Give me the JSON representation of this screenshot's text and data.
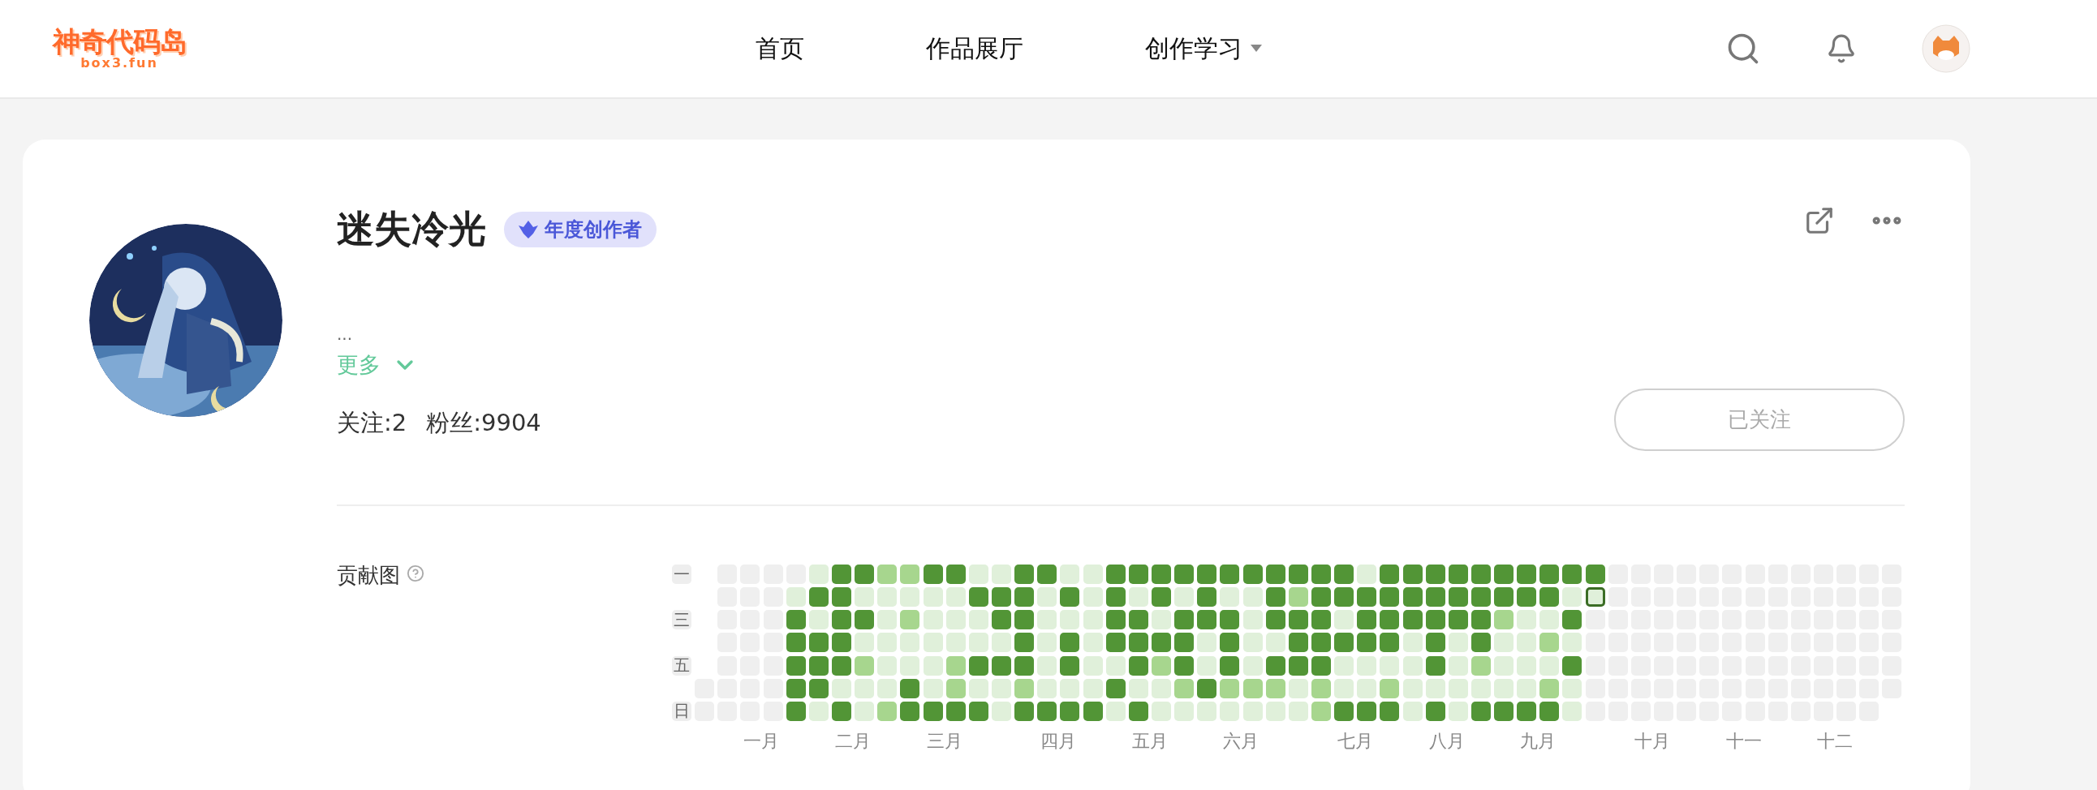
{
  "header": {
    "logo": {
      "title": "神奇代码岛",
      "subtitle": "box3.fun"
    },
    "nav": [
      {
        "label": "首页",
        "dropdown": false
      },
      {
        "label": "作品展厅",
        "dropdown": false
      },
      {
        "label": "创作学习",
        "dropdown": true
      }
    ]
  },
  "profile": {
    "avatar": {
      "kind": "picture"
    },
    "name": "迷失冷光",
    "badge": "年度创作者",
    "bio": "...",
    "more_link": "更多",
    "stats": [
      "关注:2",
      "粉丝:9904"
    ],
    "follow_button": {
      "label": "已关注",
      "following": true
    }
  },
  "contributions": {
    "title": "贡献图",
    "rows": [
      {
        "label": "一",
        "cells": [
          null,
          {
            "kind": "blank"
          },
          {
            "kind": "blank"
          },
          {
            "kind": "blank"
          },
          {
            "kind": "blank"
          },
          {
            "kind": "zero"
          },
          {
            "kind": "high"
          },
          {
            "kind": "high"
          },
          {
            "kind": "low"
          },
          {
            "kind": "low"
          },
          {
            "kind": "high"
          },
          {
            "kind": "high"
          },
          {
            "kind": "zero"
          },
          {
            "kind": "zero"
          },
          {
            "kind": "high"
          },
          {
            "kind": "high"
          },
          {
            "kind": "zero"
          },
          {
            "kind": "zero"
          },
          {
            "kind": "high"
          },
          {
            "kind": "high"
          },
          {
            "kind": "high"
          },
          {
            "kind": "high"
          },
          {
            "kind": "high"
          },
          {
            "kind": "high"
          },
          {
            "kind": "high"
          },
          {
            "kind": "high"
          },
          {
            "kind": "high"
          },
          {
            "kind": "high"
          },
          {
            "kind": "high"
          },
          {
            "kind": "zero"
          },
          {
            "kind": "high"
          },
          {
            "kind": "high"
          },
          {
            "kind": "high"
          },
          {
            "kind": "high"
          },
          {
            "kind": "high"
          },
          {
            "kind": "high"
          },
          {
            "kind": "high"
          },
          {
            "kind": "high"
          },
          {
            "kind": "high"
          },
          {
            "kind": "high"
          },
          {
            "kind": "blank"
          },
          {
            "kind": "blank"
          },
          {
            "kind": "blank"
          },
          {
            "kind": "blank"
          },
          {
            "kind": "blank"
          },
          {
            "kind": "blank"
          },
          {
            "kind": "blank"
          },
          {
            "kind": "blank"
          },
          {
            "kind": "blank"
          },
          {
            "kind": "blank"
          },
          {
            "kind": "blank"
          },
          {
            "kind": "blank"
          },
          {
            "kind": "blank"
          }
        ]
      },
      {
        "cells": [
          null,
          {
            "kind": "blank"
          },
          {
            "kind": "blank"
          },
          {
            "kind": "blank"
          },
          {
            "kind": "zero"
          },
          {
            "kind": "high"
          },
          {
            "kind": "high"
          },
          {
            "kind": "zero"
          },
          {
            "kind": "zero"
          },
          {
            "kind": "zero"
          },
          {
            "kind": "zero"
          },
          {
            "kind": "zero"
          },
          {
            "kind": "high"
          },
          {
            "kind": "high"
          },
          {
            "kind": "high"
          },
          {
            "kind": "zero"
          },
          {
            "kind": "high"
          },
          {
            "kind": "zero"
          },
          {
            "kind": "high"
          },
          {
            "kind": "zero"
          },
          {
            "kind": "high"
          },
          {
            "kind": "zero"
          },
          {
            "kind": "high"
          },
          {
            "kind": "zero"
          },
          {
            "kind": "zero"
          },
          {
            "kind": "high"
          },
          {
            "kind": "low"
          },
          {
            "kind": "high"
          },
          {
            "kind": "high"
          },
          {
            "kind": "high"
          },
          {
            "kind": "high"
          },
          {
            "kind": "high"
          },
          {
            "kind": "high"
          },
          {
            "kind": "high"
          },
          {
            "kind": "high"
          },
          {
            "kind": "high"
          },
          {
            "kind": "high"
          },
          {
            "kind": "high"
          },
          {
            "kind": "zero"
          },
          {
            "kind": "today"
          },
          {
            "kind": "blank"
          },
          {
            "kind": "blank"
          },
          {
            "kind": "blank"
          },
          {
            "kind": "blank"
          },
          {
            "kind": "blank"
          },
          {
            "kind": "blank"
          },
          {
            "kind": "blank"
          },
          {
            "kind": "blank"
          },
          {
            "kind": "blank"
          },
          {
            "kind": "blank"
          },
          {
            "kind": "blank"
          },
          {
            "kind": "blank"
          },
          {
            "kind": "blank"
          }
        ]
      },
      {
        "label": "三",
        "cells": [
          null,
          {
            "kind": "blank"
          },
          {
            "kind": "blank"
          },
          {
            "kind": "blank"
          },
          {
            "kind": "high"
          },
          {
            "kind": "zero"
          },
          {
            "kind": "high"
          },
          {
            "kind": "high"
          },
          {
            "kind": "zero"
          },
          {
            "kind": "low"
          },
          {
            "kind": "zero"
          },
          {
            "kind": "zero"
          },
          {
            "kind": "zero"
          },
          {
            "kind": "high"
          },
          {
            "kind": "high"
          },
          {
            "kind": "zero"
          },
          {
            "kind": "zero"
          },
          {
            "kind": "zero"
          },
          {
            "kind": "high"
          },
          {
            "kind": "high"
          },
          {
            "kind": "zero"
          },
          {
            "kind": "high"
          },
          {
            "kind": "high"
          },
          {
            "kind": "high"
          },
          {
            "kind": "zero"
          },
          {
            "kind": "high"
          },
          {
            "kind": "high"
          },
          {
            "kind": "high"
          },
          {
            "kind": "zero"
          },
          {
            "kind": "high"
          },
          {
            "kind": "high"
          },
          {
            "kind": "high"
          },
          {
            "kind": "high"
          },
          {
            "kind": "high"
          },
          {
            "kind": "high"
          },
          {
            "kind": "low"
          },
          {
            "kind": "zero"
          },
          {
            "kind": "zero"
          },
          {
            "kind": "high"
          },
          {
            "kind": "blank"
          },
          {
            "kind": "blank"
          },
          {
            "kind": "blank"
          },
          {
            "kind": "blank"
          },
          {
            "kind": "blank"
          },
          {
            "kind": "blank"
          },
          {
            "kind": "blank"
          },
          {
            "kind": "blank"
          },
          {
            "kind": "blank"
          },
          {
            "kind": "blank"
          },
          {
            "kind": "blank"
          },
          {
            "kind": "blank"
          },
          {
            "kind": "blank"
          },
          {
            "kind": "blank"
          }
        ]
      },
      {
        "cells": [
          null,
          {
            "kind": "blank"
          },
          {
            "kind": "blank"
          },
          {
            "kind": "blank"
          },
          {
            "kind": "high"
          },
          {
            "kind": "high"
          },
          {
            "kind": "high"
          },
          {
            "kind": "zero"
          },
          {
            "kind": "zero"
          },
          {
            "kind": "zero"
          },
          {
            "kind": "zero"
          },
          {
            "kind": "zero"
          },
          {
            "kind": "zero"
          },
          {
            "kind": "zero"
          },
          {
            "kind": "high"
          },
          {
            "kind": "zero"
          },
          {
            "kind": "high"
          },
          {
            "kind": "zero"
          },
          {
            "kind": "high"
          },
          {
            "kind": "high"
          },
          {
            "kind": "high"
          },
          {
            "kind": "high"
          },
          {
            "kind": "zero"
          },
          {
            "kind": "high"
          },
          {
            "kind": "zero"
          },
          {
            "kind": "zero"
          },
          {
            "kind": "high"
          },
          {
            "kind": "high"
          },
          {
            "kind": "high"
          },
          {
            "kind": "high"
          },
          {
            "kind": "high"
          },
          {
            "kind": "zero"
          },
          {
            "kind": "high"
          },
          {
            "kind": "zero"
          },
          {
            "kind": "high"
          },
          {
            "kind": "zero"
          },
          {
            "kind": "zero"
          },
          {
            "kind": "low"
          },
          {
            "kind": "zero"
          },
          {
            "kind": "blank"
          },
          {
            "kind": "blank"
          },
          {
            "kind": "blank"
          },
          {
            "kind": "blank"
          },
          {
            "kind": "blank"
          },
          {
            "kind": "blank"
          },
          {
            "kind": "blank"
          },
          {
            "kind": "blank"
          },
          {
            "kind": "blank"
          },
          {
            "kind": "blank"
          },
          {
            "kind": "blank"
          },
          {
            "kind": "blank"
          },
          {
            "kind": "blank"
          },
          {
            "kind": "blank"
          }
        ]
      },
      {
        "label": "五",
        "cells": [
          null,
          {
            "kind": "blank"
          },
          {
            "kind": "blank"
          },
          {
            "kind": "blank"
          },
          {
            "kind": "high"
          },
          {
            "kind": "high"
          },
          {
            "kind": "high"
          },
          {
            "kind": "low"
          },
          {
            "kind": "zero"
          },
          {
            "kind": "zero"
          },
          {
            "kind": "zero"
          },
          {
            "kind": "low"
          },
          {
            "kind": "high"
          },
          {
            "kind": "high"
          },
          {
            "kind": "high"
          },
          {
            "kind": "zero"
          },
          {
            "kind": "high"
          },
          {
            "kind": "zero"
          },
          {
            "kind": "zero"
          },
          {
            "kind": "high"
          },
          {
            "kind": "low"
          },
          {
            "kind": "high"
          },
          {
            "kind": "zero"
          },
          {
            "kind": "high"
          },
          {
            "kind": "zero"
          },
          {
            "kind": "high"
          },
          {
            "kind": "high"
          },
          {
            "kind": "high"
          },
          {
            "kind": "zero"
          },
          {
            "kind": "zero"
          },
          {
            "kind": "zero"
          },
          {
            "kind": "zero"
          },
          {
            "kind": "high"
          },
          {
            "kind": "zero"
          },
          {
            "kind": "low"
          },
          {
            "kind": "zero"
          },
          {
            "kind": "zero"
          },
          {
            "kind": "zero"
          },
          {
            "kind": "high"
          },
          {
            "kind": "blank"
          },
          {
            "kind": "blank"
          },
          {
            "kind": "blank"
          },
          {
            "kind": "blank"
          },
          {
            "kind": "blank"
          },
          {
            "kind": "blank"
          },
          {
            "kind": "blank"
          },
          {
            "kind": "blank"
          },
          {
            "kind": "blank"
          },
          {
            "kind": "blank"
          },
          {
            "kind": "blank"
          },
          {
            "kind": "blank"
          },
          {
            "kind": "blank"
          },
          {
            "kind": "blank"
          }
        ]
      },
      {
        "cells": [
          {
            "kind": "blank"
          },
          {
            "kind": "blank"
          },
          {
            "kind": "blank"
          },
          {
            "kind": "blank"
          },
          {
            "kind": "high"
          },
          {
            "kind": "high"
          },
          {
            "kind": "zero"
          },
          {
            "kind": "zero"
          },
          {
            "kind": "zero"
          },
          {
            "kind": "high"
          },
          {
            "kind": "zero"
          },
          {
            "kind": "low"
          },
          {
            "kind": "zero"
          },
          {
            "kind": "zero"
          },
          {
            "kind": "low"
          },
          {
            "kind": "zero"
          },
          {
            "kind": "zero"
          },
          {
            "kind": "zero"
          },
          {
            "kind": "high"
          },
          {
            "kind": "zero"
          },
          {
            "kind": "zero"
          },
          {
            "kind": "low"
          },
          {
            "kind": "high"
          },
          {
            "kind": "low"
          },
          {
            "kind": "low"
          },
          {
            "kind": "low"
          },
          {
            "kind": "zero"
          },
          {
            "kind": "low"
          },
          {
            "kind": "zero"
          },
          {
            "kind": "zero"
          },
          {
            "kind": "low"
          },
          {
            "kind": "zero"
          },
          {
            "kind": "zero"
          },
          {
            "kind": "zero"
          },
          {
            "kind": "zero"
          },
          {
            "kind": "zero"
          },
          {
            "kind": "zero"
          },
          {
            "kind": "low"
          },
          {
            "kind": "zero"
          },
          {
            "kind": "blank"
          },
          {
            "kind": "blank"
          },
          {
            "kind": "blank"
          },
          {
            "kind": "blank"
          },
          {
            "kind": "blank"
          },
          {
            "kind": "blank"
          },
          {
            "kind": "blank"
          },
          {
            "kind": "blank"
          },
          {
            "kind": "blank"
          },
          {
            "kind": "blank"
          },
          {
            "kind": "blank"
          },
          {
            "kind": "blank"
          },
          {
            "kind": "blank"
          },
          {
            "kind": "blank"
          }
        ]
      },
      {
        "label": "日",
        "cells": [
          {
            "kind": "blank"
          },
          {
            "kind": "blank"
          },
          {
            "kind": "blank"
          },
          {
            "kind": "blank"
          },
          {
            "kind": "high"
          },
          {
            "kind": "zero"
          },
          {
            "kind": "high"
          },
          {
            "kind": "zero"
          },
          {
            "kind": "low"
          },
          {
            "kind": "high"
          },
          {
            "kind": "high"
          },
          {
            "kind": "high"
          },
          {
            "kind": "high"
          },
          {
            "kind": "zero"
          },
          {
            "kind": "high"
          },
          {
            "kind": "high"
          },
          {
            "kind": "high"
          },
          {
            "kind": "high"
          },
          {
            "kind": "zero"
          },
          {
            "kind": "high"
          },
          {
            "kind": "zero"
          },
          {
            "kind": "zero"
          },
          {
            "kind": "zero"
          },
          {
            "kind": "zero"
          },
          {
            "kind": "zero"
          },
          {
            "kind": "zero"
          },
          {
            "kind": "zero"
          },
          {
            "kind": "low"
          },
          {
            "kind": "high"
          },
          {
            "kind": "high"
          },
          {
            "kind": "high"
          },
          {
            "kind": "zero"
          },
          {
            "kind": "high"
          },
          {
            "kind": "zero"
          },
          {
            "kind": "high"
          },
          {
            "kind": "high"
          },
          {
            "kind": "high"
          },
          {
            "kind": "high"
          },
          {
            "kind": "zero"
          },
          {
            "kind": "blank"
          },
          {
            "kind": "blank"
          },
          {
            "kind": "blank"
          },
          {
            "kind": "blank"
          },
          {
            "kind": "blank"
          },
          {
            "kind": "blank"
          },
          {
            "kind": "blank"
          },
          {
            "kind": "blank"
          },
          {
            "kind": "blank"
          },
          {
            "kind": "blank"
          },
          {
            "kind": "blank"
          },
          {
            "kind": "blank"
          },
          {
            "kind": "blank"
          },
          null
        ]
      }
    ],
    "months": [
      "一月",
      "二月",
      "三月",
      "四月",
      "五月",
      "六月",
      "七月",
      "八月",
      "九月",
      "十月",
      "十一",
      "十二"
    ]
  }
}
